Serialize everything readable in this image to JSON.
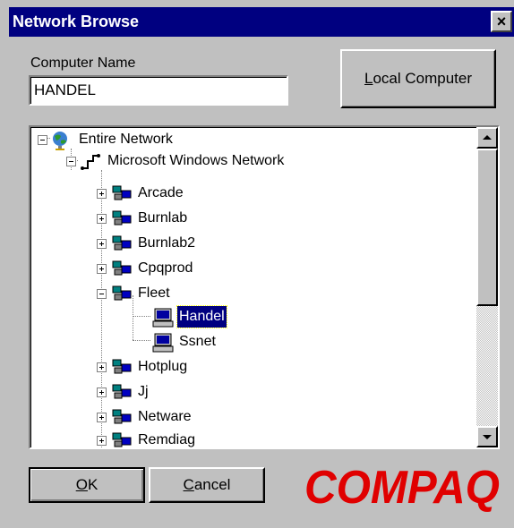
{
  "window": {
    "title": "Network Browse",
    "close_label": "×"
  },
  "computer_name": {
    "label": "Computer Name",
    "value": "HANDEL"
  },
  "buttons": {
    "local_computer": {
      "label": "Local Computer",
      "mnemonic": "L",
      "rest": "ocal Computer"
    },
    "ok": {
      "label": "OK",
      "mnemonic": "O",
      "rest": "K"
    },
    "cancel": {
      "label": "Cancel",
      "mnemonic": "C",
      "rest": "ancel"
    }
  },
  "tree": {
    "root": "Entire Network",
    "network": "Microsoft Windows Network",
    "groups": [
      "Arcade",
      "Burnlab",
      "Burnlab2",
      "Cpqprod",
      "Fleet",
      "Hotplug",
      "Jj",
      "Netware",
      "Remdiag"
    ],
    "fleet_children": [
      "Handel",
      "Ssnet"
    ],
    "selected": "Handel"
  },
  "brand": {
    "logo_text": "COMPAQ",
    "color": "#e00000"
  },
  "colors": {
    "title_bar": "#000080",
    "selection": "#000080",
    "face": "#c0c0c0"
  },
  "icons": {
    "root": "globe-icon",
    "network": "network-icon",
    "workgroup": "workgroup-icon",
    "computer": "computer-icon"
  }
}
